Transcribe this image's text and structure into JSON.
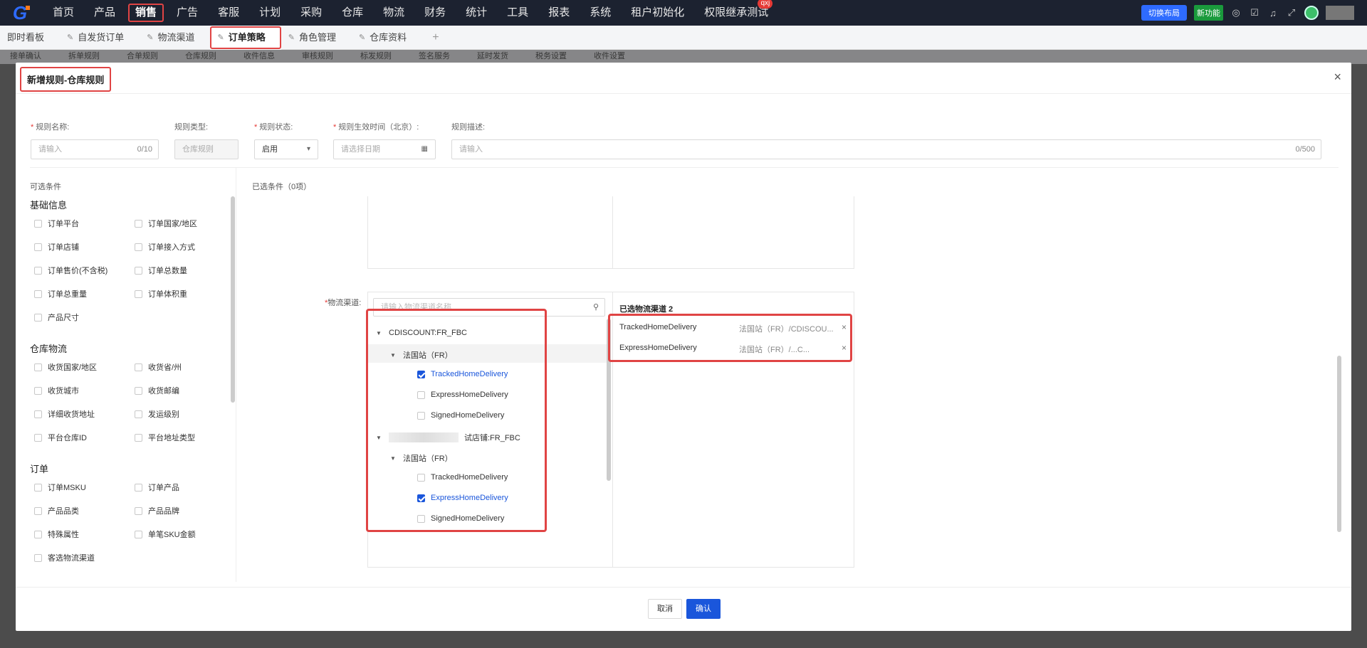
{
  "nav": {
    "items": [
      "首页",
      "产品",
      "销售",
      "广告",
      "客服",
      "计划",
      "采购",
      "仓库",
      "物流",
      "财务",
      "统计",
      "工具",
      "报表",
      "系统",
      "租户初始化",
      "权限继承测试"
    ],
    "badge": "qxj",
    "switch_layout": "切换布局",
    "new_feature": "新功能"
  },
  "tabs": {
    "items": [
      "即时看板",
      "自发货订单",
      "物流渠道",
      "订单策略",
      "角色管理",
      "仓库资料"
    ],
    "add": "+"
  },
  "subtabs": [
    "接单确认",
    "拆单规则",
    "合单规则",
    "仓库规则",
    "收件信息",
    "审核规则",
    "标发规则",
    "签名服务",
    "延时发货",
    "税务设置",
    "收件设置"
  ],
  "modal": {
    "title": "新增规则-仓库规则",
    "close": "×",
    "fields": {
      "name_label": "规则名称:",
      "name_placeholder": "请输入",
      "name_count": "0/10",
      "type_label": "规则类型:",
      "type_value": "仓库规则",
      "status_label": "规则状态:",
      "status_value": "启用",
      "time_label": "规则生效时间（北京）:",
      "time_placeholder": "请选择日期",
      "desc_label": "规则描述:",
      "desc_placeholder": "请输入",
      "desc_count": "0/500"
    },
    "available_title": "可选条件",
    "groups": [
      {
        "title": "基础信息",
        "options": [
          "订单平台",
          "订单国家/地区",
          "订单店铺",
          "订单接入方式",
          "订单售价(不含税)",
          "订单总数量",
          "订单总重量",
          "订单体积重",
          "产品尺寸"
        ]
      },
      {
        "title": "仓库物流",
        "options": [
          "收货国家/地区",
          "收货省/州",
          "收货城市",
          "收货邮编",
          "详细收货地址",
          "发运级别",
          "平台仓库ID",
          "平台地址类型"
        ]
      },
      {
        "title": "订单",
        "options": [
          "订单MSKU",
          "订单产品",
          "产品品类",
          "产品品牌",
          "特殊属性",
          "单笔SKU金额",
          "客选物流渠道"
        ]
      }
    ],
    "selected_title": "已选条件（0项）",
    "logistics_label": "物流渠道:",
    "search_placeholder": "请输入物流渠道名称",
    "tree": {
      "store1": "CDISCOUNT:FR_FBC",
      "site1": "法国站（FR）",
      "store2_suffix": "试店铺:FR_FBC",
      "site2": "法国站（FR）",
      "channels": [
        "TrackedHomeDelivery",
        "ExpressHomeDelivery",
        "SignedHomeDelivery"
      ],
      "checked1": [
        true,
        false,
        false
      ],
      "checked2": [
        false,
        true,
        false
      ]
    },
    "chosen": {
      "title": "已选物流渠道 2",
      "items": [
        {
          "name": "TrackedHomeDelivery",
          "route": "法国站（FR）/CDISCOU..."
        },
        {
          "name": "ExpressHomeDelivery",
          "route": "法国站（FR）/...C..."
        }
      ]
    },
    "cancel": "取消",
    "confirm": "确认"
  }
}
